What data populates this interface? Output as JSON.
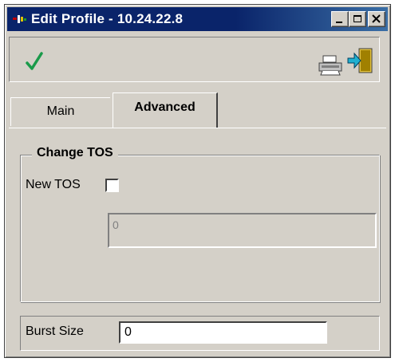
{
  "window": {
    "title": "Edit Profile - 10.24.22.8",
    "buttons": {
      "minimize": "minimize-icon",
      "maximize": "maximize-icon",
      "close": "close-icon"
    }
  },
  "toolbar": {
    "ok_icon": "checkmark-icon",
    "print_icon": "printer-icon",
    "exit_icon": "exit-door-icon",
    "ok_color": "#1a9a4a"
  },
  "tabs": [
    {
      "label": "Main",
      "active": false
    },
    {
      "label": "Advanced",
      "active": true
    }
  ],
  "change_tos": {
    "group_title": "Change TOS",
    "new_tos_label": "New TOS",
    "new_tos_checked": false,
    "tos_value": "0"
  },
  "burst": {
    "label": "Burst Size",
    "value": "0"
  }
}
